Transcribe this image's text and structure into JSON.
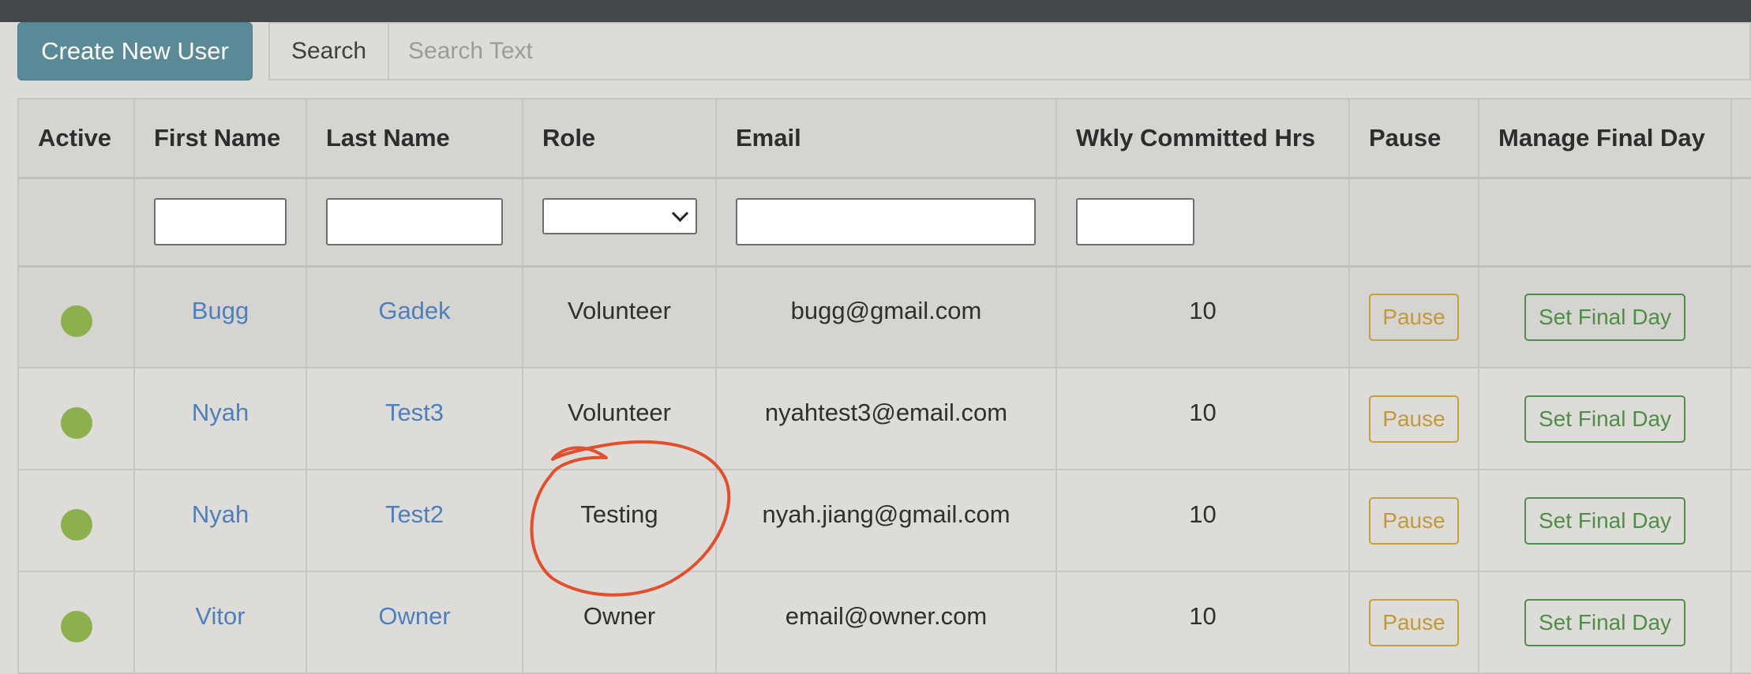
{
  "toolbar": {
    "create_label": "Create New User",
    "search_label": "Search",
    "search_placeholder": "Search Text",
    "search_value": ""
  },
  "table": {
    "headers": [
      "Active",
      "First Name",
      "Last Name",
      "Role",
      "Email",
      "Wkly Committed Hrs",
      "Pause",
      "Manage Final Day"
    ],
    "rows": [
      {
        "active": true,
        "first_name": "Bugg",
        "last_name": "Gadek",
        "role": "Volunteer",
        "email": "bugg@gmail.com",
        "hours": "10",
        "pause_label": "Pause",
        "final_label": "Set Final Day"
      },
      {
        "active": true,
        "first_name": "Nyah",
        "last_name": "Test3",
        "role": "Volunteer",
        "email": "nyahtest3@email.com",
        "hours": "10",
        "pause_label": "Pause",
        "final_label": "Set Final Day"
      },
      {
        "active": true,
        "first_name": "Nyah",
        "last_name": "Test2",
        "role": "Testing",
        "email": "nyah.jiang@gmail.com",
        "hours": "10",
        "pause_label": "Pause",
        "final_label": "Set Final Day"
      },
      {
        "active": true,
        "first_name": "Vitor",
        "last_name": "Owner",
        "role": "Owner",
        "email": "email@owner.com",
        "hours": "10",
        "pause_label": "Pause",
        "final_label": "Set Final Day"
      }
    ]
  },
  "colors": {
    "top_bar": "#41474b",
    "create_button": "#5a8a98",
    "active_dot": "#8bb04d",
    "link": "#4e7fbd",
    "pause": "#c2993a",
    "final_day": "#4f8e46",
    "annotation_circle": "#e0502e"
  }
}
